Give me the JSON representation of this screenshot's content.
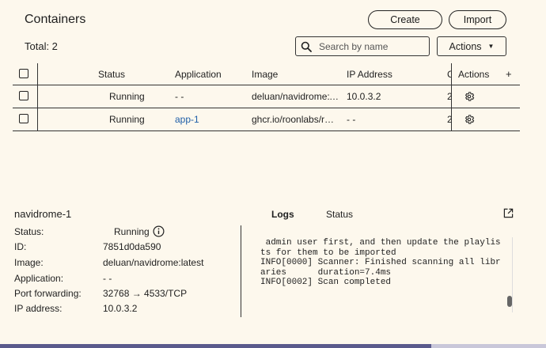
{
  "header": {
    "title": "Containers",
    "create_label": "Create",
    "import_label": "Import",
    "total": "Total: 2",
    "search_placeholder": "Search by name",
    "actions_label": "Actions"
  },
  "table": {
    "columns": {
      "status": "Status",
      "application": "Application",
      "image": "Image",
      "ip": "IP Address",
      "extra": "C",
      "actions": "Actions",
      "add": "+"
    },
    "rows": [
      {
        "status": "Running",
        "application": "- -",
        "image": "deluan/navidrome:latest",
        "ip": "10.0.3.2",
        "extra": "2"
      },
      {
        "status": "Running",
        "application": "app-1",
        "image": "ghcr.io/roonlabs/roonserver",
        "ip": "- -",
        "extra": "2"
      }
    ]
  },
  "detail": {
    "name": "navidrome-1",
    "fields": [
      {
        "label": "Status:",
        "value": "Running"
      },
      {
        "label": "ID:",
        "value": "7851d0da590"
      },
      {
        "label": "Image:",
        "value": "deluan/navidrome:latest"
      },
      {
        "label": "Application:",
        "value": "- -"
      },
      {
        "label": "Port forwarding:",
        "value": "32768 → 4533/TCP"
      },
      {
        "label": "IP address:",
        "value": "10.0.3.2"
      }
    ],
    "tabs": {
      "logs": "Logs",
      "status": "Status"
    },
    "log_text": " admin user first, and then update the playlis\nts for them to be imported\nINFO[0000] Scanner: Finished scanning all libr\naries      duration=7.4ms\nINFO[0002] Scan completed"
  },
  "icons": {
    "search": "search-icon",
    "caret": "caret-down-icon",
    "gear": "gear-icon",
    "info": "info-icon",
    "open_external": "open-in-new-icon"
  },
  "colors": {
    "background": "#fdf8ed",
    "link": "#1f5ea8",
    "progress": "#5a5a8c"
  }
}
